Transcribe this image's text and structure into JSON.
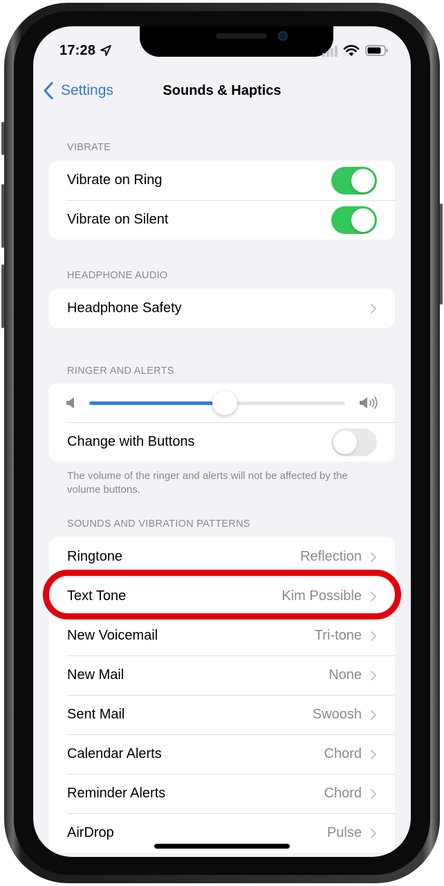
{
  "status_bar": {
    "time": "17:28",
    "location_icon": "location-arrow-icon",
    "signal_icon": "cellular-signal-icon",
    "wifi_icon": "wifi-icon",
    "battery_icon": "battery-icon"
  },
  "nav": {
    "back_label": "Settings",
    "title": "Sounds & Haptics"
  },
  "sections": {
    "vibrate": {
      "header": "VIBRATE",
      "rows": [
        {
          "label": "Vibrate on Ring",
          "toggle": true
        },
        {
          "label": "Vibrate on Silent",
          "toggle": true
        }
      ]
    },
    "headphone_audio": {
      "header": "HEADPHONE AUDIO",
      "rows": [
        {
          "label": "Headphone Safety"
        }
      ]
    },
    "ringer_alerts": {
      "header": "RINGER AND ALERTS",
      "volume": 0.53,
      "rows": [
        {
          "label": "Change with Buttons",
          "toggle": false
        }
      ],
      "footer": "The volume of the ringer and alerts will not be affected by the volume buttons."
    },
    "sounds_patterns": {
      "header": "SOUNDS AND VIBRATION PATTERNS",
      "rows": [
        {
          "label": "Ringtone",
          "value": "Reflection"
        },
        {
          "label": "Text Tone",
          "value": "Kim Possible",
          "highlighted": true
        },
        {
          "label": "New Voicemail",
          "value": "Tri-tone"
        },
        {
          "label": "New Mail",
          "value": "None"
        },
        {
          "label": "Sent Mail",
          "value": "Swoosh"
        },
        {
          "label": "Calendar Alerts",
          "value": "Chord"
        },
        {
          "label": "Reminder Alerts",
          "value": "Chord"
        },
        {
          "label": "AirDrop",
          "value": "Pulse"
        }
      ]
    }
  },
  "colors": {
    "accent": "#3478d8",
    "toggle_on": "#34c759",
    "slider_fill": "#2f7de1",
    "annotation": "#e3000b",
    "background": "#f2f2f7"
  }
}
